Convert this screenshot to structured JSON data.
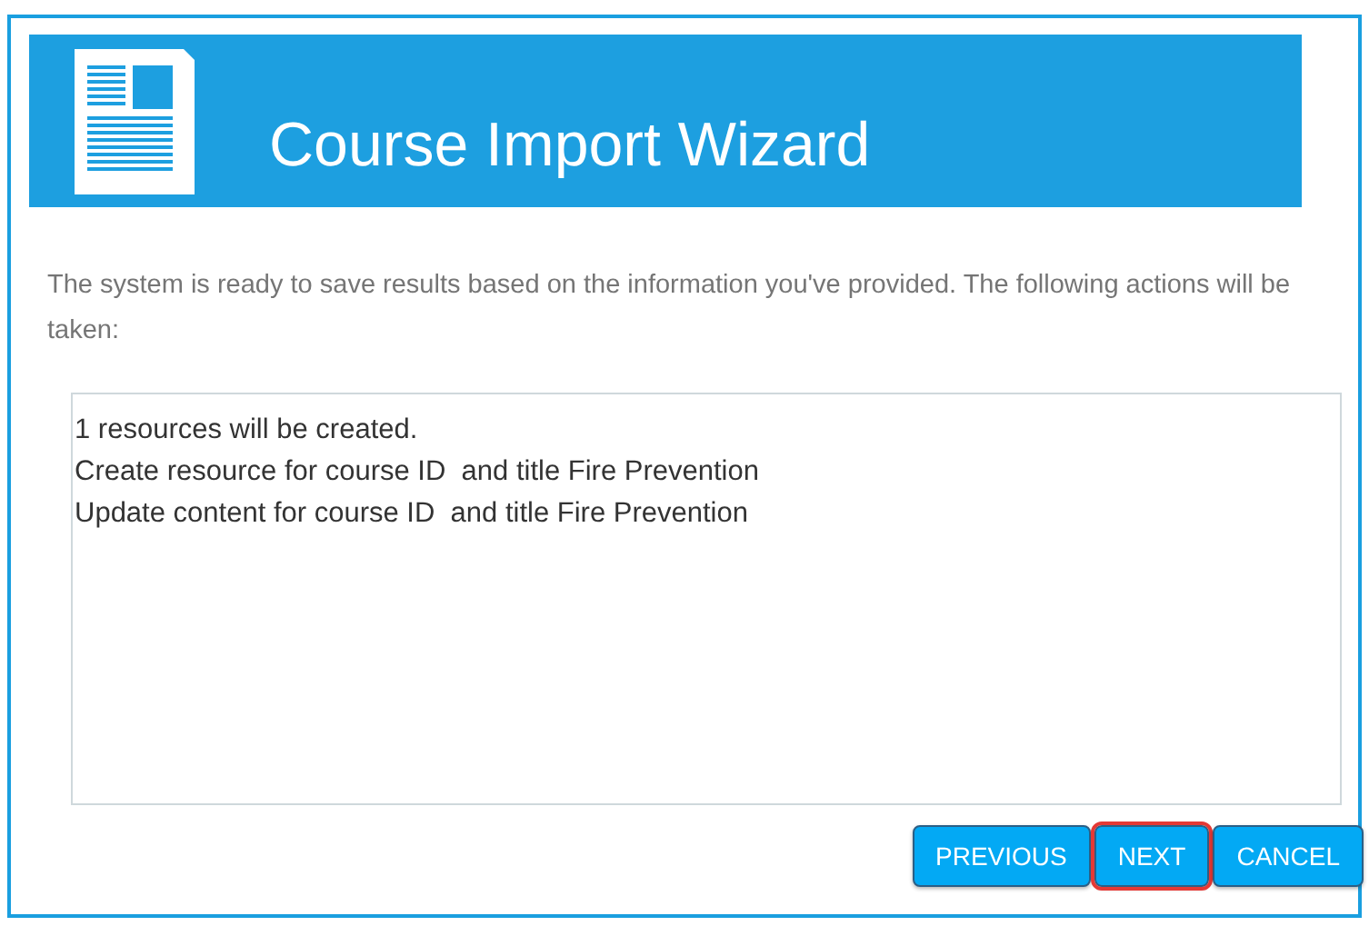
{
  "header": {
    "title": "Course Import Wizard"
  },
  "intro": "The system is ready to save results based on the information you've provided. The following actions will be taken:",
  "actions": [
    "1 resources will be created.",
    "Create resource for course ID  and title Fire Prevention",
    "Update content for course ID  and title Fire Prevention"
  ],
  "buttons": [
    {
      "label": "PREVIOUS",
      "highlighted": false
    },
    {
      "label": "NEXT",
      "highlighted": true
    },
    {
      "label": "CANCEL",
      "highlighted": false
    }
  ]
}
